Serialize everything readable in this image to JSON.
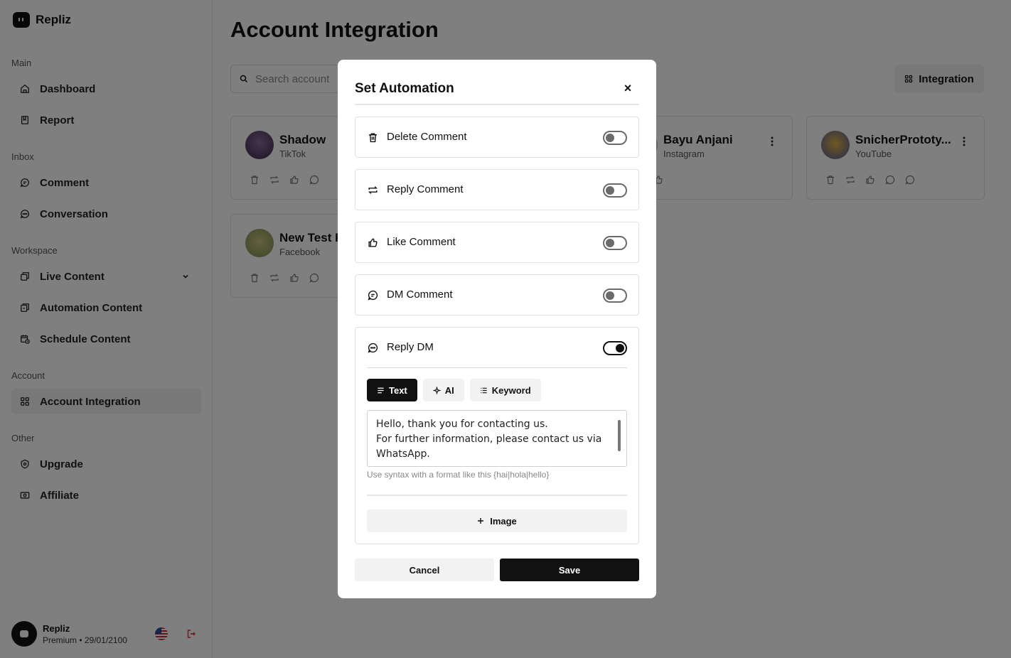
{
  "brand": {
    "name": "Repliz"
  },
  "sidebar": {
    "sections": [
      "Main",
      "Inbox",
      "Workspace",
      "Account",
      "Other"
    ],
    "items": [
      {
        "label": "Dashboard",
        "icon": "home-icon"
      },
      {
        "label": "Report",
        "icon": "book-icon"
      },
      {
        "label": "Comment",
        "icon": "comment-icon"
      },
      {
        "label": "Conversation",
        "icon": "chat-icon"
      },
      {
        "label": "Live Content",
        "icon": "copy-icon"
      },
      {
        "label": "Automation Content",
        "icon": "automation-icon"
      },
      {
        "label": "Schedule Content",
        "icon": "calendar-icon"
      },
      {
        "label": "Account Integration",
        "icon": "grid-icon",
        "active": true
      },
      {
        "label": "Upgrade",
        "icon": "shield-icon"
      },
      {
        "label": "Affiliate",
        "icon": "money-icon"
      }
    ]
  },
  "user": {
    "name": "Repliz",
    "plan": "Premium • 29/01/2100"
  },
  "main": {
    "title": "Account Integration",
    "search_placeholder": "Search account",
    "integration_label": "Integration",
    "cards": [
      {
        "name": "Shadow",
        "platform": "TikTok"
      },
      {
        "name": "Bayu Anjani",
        "platform": "Instagram"
      },
      {
        "name": "SnicherPrototy...",
        "platform": "YouTube"
      },
      {
        "name": "New Test P",
        "platform": "Facebook"
      }
    ]
  },
  "modal": {
    "title": "Set Automation",
    "close": "×",
    "options": [
      {
        "label": "Delete Comment",
        "enabled": false
      },
      {
        "label": "Reply Comment",
        "enabled": false
      },
      {
        "label": "Like Comment",
        "enabled": false
      },
      {
        "label": "DM Comment",
        "enabled": false
      },
      {
        "label": "Reply DM",
        "enabled": true
      }
    ],
    "tabs": [
      "Text",
      "AI",
      "Keyword"
    ],
    "active_tab": "Text",
    "message": "Hello, thank you for contacting us.\nFor further information, please contact us via WhatsApp.",
    "hint": "Use syntax with a format like this {hai|hola|hello}",
    "image_label": "Image",
    "cancel_label": "Cancel",
    "save_label": "Save"
  }
}
